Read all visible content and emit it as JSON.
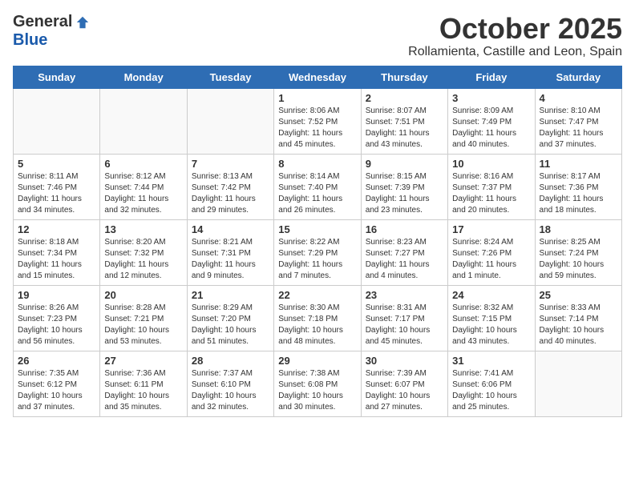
{
  "logo": {
    "general": "General",
    "blue": "Blue"
  },
  "header": {
    "month": "October 2025",
    "location": "Rollamienta, Castille and Leon, Spain"
  },
  "weekdays": [
    "Sunday",
    "Monday",
    "Tuesday",
    "Wednesday",
    "Thursday",
    "Friday",
    "Saturday"
  ],
  "weeks": [
    [
      {
        "day": "",
        "info": ""
      },
      {
        "day": "",
        "info": ""
      },
      {
        "day": "",
        "info": ""
      },
      {
        "day": "1",
        "info": "Sunrise: 8:06 AM\nSunset: 7:52 PM\nDaylight: 11 hours and 45 minutes."
      },
      {
        "day": "2",
        "info": "Sunrise: 8:07 AM\nSunset: 7:51 PM\nDaylight: 11 hours and 43 minutes."
      },
      {
        "day": "3",
        "info": "Sunrise: 8:09 AM\nSunset: 7:49 PM\nDaylight: 11 hours and 40 minutes."
      },
      {
        "day": "4",
        "info": "Sunrise: 8:10 AM\nSunset: 7:47 PM\nDaylight: 11 hours and 37 minutes."
      }
    ],
    [
      {
        "day": "5",
        "info": "Sunrise: 8:11 AM\nSunset: 7:46 PM\nDaylight: 11 hours and 34 minutes."
      },
      {
        "day": "6",
        "info": "Sunrise: 8:12 AM\nSunset: 7:44 PM\nDaylight: 11 hours and 32 minutes."
      },
      {
        "day": "7",
        "info": "Sunrise: 8:13 AM\nSunset: 7:42 PM\nDaylight: 11 hours and 29 minutes."
      },
      {
        "day": "8",
        "info": "Sunrise: 8:14 AM\nSunset: 7:40 PM\nDaylight: 11 hours and 26 minutes."
      },
      {
        "day": "9",
        "info": "Sunrise: 8:15 AM\nSunset: 7:39 PM\nDaylight: 11 hours and 23 minutes."
      },
      {
        "day": "10",
        "info": "Sunrise: 8:16 AM\nSunset: 7:37 PM\nDaylight: 11 hours and 20 minutes."
      },
      {
        "day": "11",
        "info": "Sunrise: 8:17 AM\nSunset: 7:36 PM\nDaylight: 11 hours and 18 minutes."
      }
    ],
    [
      {
        "day": "12",
        "info": "Sunrise: 8:18 AM\nSunset: 7:34 PM\nDaylight: 11 hours and 15 minutes."
      },
      {
        "day": "13",
        "info": "Sunrise: 8:20 AM\nSunset: 7:32 PM\nDaylight: 11 hours and 12 minutes."
      },
      {
        "day": "14",
        "info": "Sunrise: 8:21 AM\nSunset: 7:31 PM\nDaylight: 11 hours and 9 minutes."
      },
      {
        "day": "15",
        "info": "Sunrise: 8:22 AM\nSunset: 7:29 PM\nDaylight: 11 hours and 7 minutes."
      },
      {
        "day": "16",
        "info": "Sunrise: 8:23 AM\nSunset: 7:27 PM\nDaylight: 11 hours and 4 minutes."
      },
      {
        "day": "17",
        "info": "Sunrise: 8:24 AM\nSunset: 7:26 PM\nDaylight: 11 hours and 1 minute."
      },
      {
        "day": "18",
        "info": "Sunrise: 8:25 AM\nSunset: 7:24 PM\nDaylight: 10 hours and 59 minutes."
      }
    ],
    [
      {
        "day": "19",
        "info": "Sunrise: 8:26 AM\nSunset: 7:23 PM\nDaylight: 10 hours and 56 minutes."
      },
      {
        "day": "20",
        "info": "Sunrise: 8:28 AM\nSunset: 7:21 PM\nDaylight: 10 hours and 53 minutes."
      },
      {
        "day": "21",
        "info": "Sunrise: 8:29 AM\nSunset: 7:20 PM\nDaylight: 10 hours and 51 minutes."
      },
      {
        "day": "22",
        "info": "Sunrise: 8:30 AM\nSunset: 7:18 PM\nDaylight: 10 hours and 48 minutes."
      },
      {
        "day": "23",
        "info": "Sunrise: 8:31 AM\nSunset: 7:17 PM\nDaylight: 10 hours and 45 minutes."
      },
      {
        "day": "24",
        "info": "Sunrise: 8:32 AM\nSunset: 7:15 PM\nDaylight: 10 hours and 43 minutes."
      },
      {
        "day": "25",
        "info": "Sunrise: 8:33 AM\nSunset: 7:14 PM\nDaylight: 10 hours and 40 minutes."
      }
    ],
    [
      {
        "day": "26",
        "info": "Sunrise: 7:35 AM\nSunset: 6:12 PM\nDaylight: 10 hours and 37 minutes."
      },
      {
        "day": "27",
        "info": "Sunrise: 7:36 AM\nSunset: 6:11 PM\nDaylight: 10 hours and 35 minutes."
      },
      {
        "day": "28",
        "info": "Sunrise: 7:37 AM\nSunset: 6:10 PM\nDaylight: 10 hours and 32 minutes."
      },
      {
        "day": "29",
        "info": "Sunrise: 7:38 AM\nSunset: 6:08 PM\nDaylight: 10 hours and 30 minutes."
      },
      {
        "day": "30",
        "info": "Sunrise: 7:39 AM\nSunset: 6:07 PM\nDaylight: 10 hours and 27 minutes."
      },
      {
        "day": "31",
        "info": "Sunrise: 7:41 AM\nSunset: 6:06 PM\nDaylight: 10 hours and 25 minutes."
      },
      {
        "day": "",
        "info": ""
      }
    ]
  ]
}
